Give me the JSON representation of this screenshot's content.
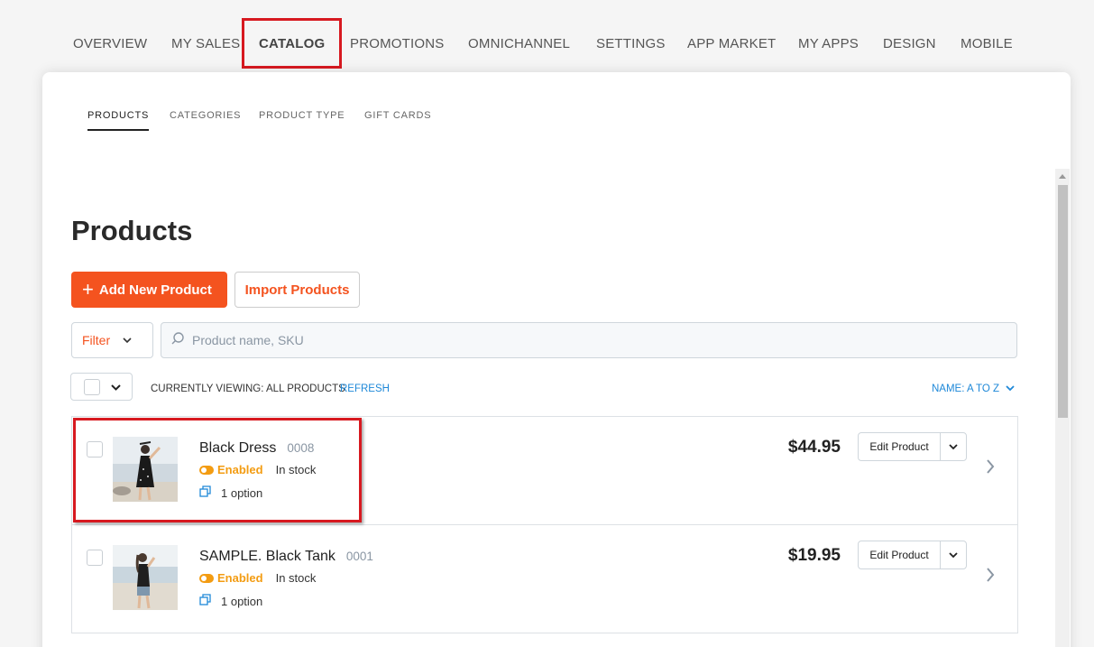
{
  "top_nav": [
    {
      "label": "OVERVIEW"
    },
    {
      "label": "MY SALES"
    },
    {
      "label": "CATALOG"
    },
    {
      "label": "PROMOTIONS"
    },
    {
      "label": "OMNICHANNEL"
    },
    {
      "label": "SETTINGS"
    },
    {
      "label": "APP MARKET"
    },
    {
      "label": "MY APPS"
    },
    {
      "label": "DESIGN"
    },
    {
      "label": "MOBILE"
    }
  ],
  "sub_nav": [
    {
      "label": "PRODUCTS"
    },
    {
      "label": "CATEGORIES"
    },
    {
      "label": "PRODUCT TYPE"
    },
    {
      "label": "GIFT CARDS"
    }
  ],
  "page": {
    "title": "Products"
  },
  "actions": {
    "add_label": "Add New Product",
    "import_label": "Import Products"
  },
  "filter": {
    "label": "Filter"
  },
  "search": {
    "placeholder": "Product name, SKU"
  },
  "toolbar": {
    "viewing": "CURRENTLY VIEWING: ALL PRODUCTS",
    "refresh": "REFRESH",
    "sort": "NAME: A TO Z"
  },
  "products": [
    {
      "name": "Black Dress",
      "sku": "0008",
      "status": "Enabled",
      "stock": "In stock",
      "options": "1 option",
      "price": "$44.95",
      "edit_label": "Edit Product"
    },
    {
      "name": "SAMPLE. Black Tank",
      "sku": "0001",
      "status": "Enabled",
      "stock": "In stock",
      "options": "1 option",
      "price": "$19.95",
      "edit_label": "Edit Product"
    }
  ],
  "colors": {
    "accent": "#f4531f",
    "link": "#1e88d8",
    "enabled": "#f39c12",
    "highlight": "#d71920"
  }
}
